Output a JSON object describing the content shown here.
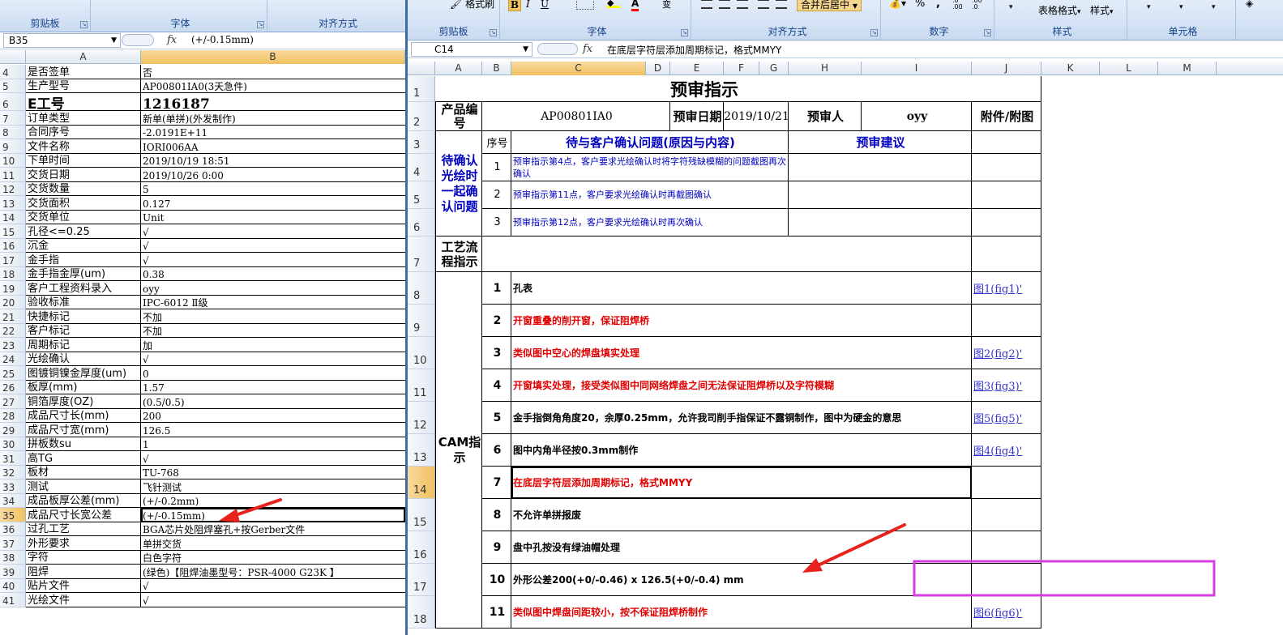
{
  "left": {
    "ribbon": {
      "groups": [
        "剪贴板",
        "字体",
        "对齐方式"
      ]
    },
    "name_box": "B35",
    "formula": "(+/-0.15mm)",
    "columns": [
      "A",
      "B"
    ],
    "rows": [
      {
        "num": "4",
        "a": "是否签单",
        "b": "否"
      },
      {
        "num": "5",
        "a": "生产型号",
        "b": "AP00801IA0(3天急件)"
      },
      {
        "num": "6",
        "a": "E工号",
        "b": "1216187"
      },
      {
        "num": "7",
        "a": "订单类型",
        "b": "新单(单拼)(外发制作)"
      },
      {
        "num": "8",
        "a": "合同序号",
        "b": "-2.0191E+11"
      },
      {
        "num": "9",
        "a": "文件名称",
        "b": "IORI006AA"
      },
      {
        "num": "10",
        "a": "下单时间",
        "b": "2019/10/19 18:51"
      },
      {
        "num": "11",
        "a": "交货日期",
        "b": "2019/10/26 0:00"
      },
      {
        "num": "12",
        "a": "交货数量",
        "b": "5"
      },
      {
        "num": "13",
        "a": "交货面积",
        "b": "0.127"
      },
      {
        "num": "14",
        "a": "交货单位",
        "b": "Unit"
      },
      {
        "num": "15",
        "a": "孔径<=0.25",
        "b": "√"
      },
      {
        "num": "16",
        "a": "沉金",
        "b": "√"
      },
      {
        "num": "17",
        "a": "金手指",
        "b": "√"
      },
      {
        "num": "18",
        "a": "金手指金厚(um)",
        "b": "0.38"
      },
      {
        "num": "19",
        "a": "客户工程资料录入",
        "b": "oyy"
      },
      {
        "num": "20",
        "a": "验收标准",
        "b": "IPC-6012 Ⅱ级"
      },
      {
        "num": "21",
        "a": "快捷标记",
        "b": "不加"
      },
      {
        "num": "22",
        "a": "客户标记",
        "b": "不加"
      },
      {
        "num": "23",
        "a": "周期标记",
        "b": "加"
      },
      {
        "num": "24",
        "a": "光绘确认",
        "b": "√"
      },
      {
        "num": "25",
        "a": "图镀铜镍金厚度(um)",
        "b": "0"
      },
      {
        "num": "26",
        "a": "板厚(mm)",
        "b": "1.57"
      },
      {
        "num": "27",
        "a": "铜箔厚度(OZ)",
        "b": "(0.5/0.5)"
      },
      {
        "num": "28",
        "a": "成品尺寸长(mm)",
        "b": "200"
      },
      {
        "num": "29",
        "a": "成品尺寸宽(mm)",
        "b": "126.5"
      },
      {
        "num": "30",
        "a": "拼板数su",
        "b": "1"
      },
      {
        "num": "31",
        "a": "高TG",
        "b": "√"
      },
      {
        "num": "32",
        "a": "板材",
        "b": "TU-768"
      },
      {
        "num": "33",
        "a": "测试",
        "b": "飞针测试"
      },
      {
        "num": "34",
        "a": "成品板厚公差(mm)",
        "b": "(+/-0.2mm)"
      },
      {
        "num": "35",
        "a": "成品尺寸长宽公差",
        "b": "(+/-0.15mm)"
      },
      {
        "num": "36",
        "a": "过孔工艺",
        "b": "BGA芯片处阻焊塞孔+按Gerber文件"
      },
      {
        "num": "37",
        "a": "外形要求",
        "b": "单拼交货"
      },
      {
        "num": "38",
        "a": "字符",
        "b": "白色字符"
      },
      {
        "num": "39",
        "a": "阻焊",
        "b": "(绿色)【阻焊油墨型号：PSR-4000 G23K 】"
      },
      {
        "num": "40",
        "a": "贴片文件",
        "b": "√"
      },
      {
        "num": "41",
        "a": "光绘文件",
        "b": "√"
      }
    ]
  },
  "right": {
    "ribbon": {
      "buttons": {
        "format_painter": "格式刷",
        "merge_center": "合并后居中",
        "table_format": "表格格式",
        "style": "样式",
        "percent": "%",
        "comma": ",",
        "bold": "B",
        "italic": "I",
        "underline": "U",
        "font_color": "A",
        "inc_decimal": ".0 .00",
        "dec_decimal": ".00 .0",
        "wrap": "变"
      },
      "groups": [
        "剪贴板",
        "字体",
        "对齐方式",
        "数字",
        "样式",
        "单元格"
      ]
    },
    "name_box": "C14",
    "formula": "在底层字符层添加周期标记，格式MMYY",
    "columns": [
      "A",
      "B",
      "C",
      "D",
      "E",
      "F",
      "G",
      "H",
      "I",
      "J",
      "K",
      "L",
      "M"
    ],
    "row_numbers": [
      "1",
      "2",
      "3",
      "4",
      "5",
      "6",
      "7",
      "8",
      "9",
      "10",
      "11",
      "12",
      "13",
      "14",
      "15",
      "16",
      "17",
      "18"
    ],
    "sheet": {
      "title": "预审指示",
      "product_label": "产品编号",
      "product_value": "AP00801IA0",
      "date_label": "预审日期",
      "date_value": "2019/10/21",
      "reviewer_label": "预审人",
      "reviewer_value": "oyy",
      "attach_label": "附件/附图",
      "seq_label": "序号",
      "confirm_header": "待与客户确认问题(原因与内容)",
      "advice_header": "预审建议",
      "confirm_section": "待确认光绘时一起确认问题",
      "confirm_items": [
        {
          "seq": "1",
          "text": "预审指示第4点，客户要求光绘确认时将字符残缺模糊的问题截图再次确认"
        },
        {
          "seq": "2",
          "text": "预审指示第11点，客户要求光绘确认时再截图确认"
        },
        {
          "seq": "3",
          "text": "预审指示第12点，客户要求光绘确认时再次确认"
        }
      ],
      "process_label": "工艺流程指示",
      "cam_label": "CAM指示",
      "cam_items": [
        {
          "seq": "1",
          "text": "孔表",
          "red": false,
          "link": "图1(fig1)'"
        },
        {
          "seq": "2",
          "text": "开窗重叠的削开窗，保证阻焊桥",
          "red": true,
          "link": ""
        },
        {
          "seq": "3",
          "text": "类似图中空心的焊盘填实处理",
          "red": true,
          "link": "图2(fig2)'"
        },
        {
          "seq": "4",
          "text": "开窗填实处理，接受类似图中同网络焊盘之间无法保证阻焊桥以及字符模糊",
          "red": true,
          "link": "图3(fig3)'"
        },
        {
          "seq": "5",
          "text": "金手指倒角角度20，余厚0.25mm，允许我司削手指保证不露铜制作，图中为硬金的意思",
          "red": false,
          "link": "图5(fig5)'"
        },
        {
          "seq": "6",
          "text": "图中内角半径按0.3mm制作",
          "red": false,
          "link": "图4(fig4)'"
        },
        {
          "seq": "7",
          "text": "在底层字符层添加周期标记，格式MMYY",
          "red": true,
          "link": ""
        },
        {
          "seq": "8",
          "text": "不允许单拼报废",
          "red": false,
          "link": ""
        },
        {
          "seq": "9",
          "text": "盘中孔按没有绿油帽处理",
          "red": false,
          "link": ""
        },
        {
          "seq": "10",
          "text": "外形公差200(+0/-0.46) x 126.5(+0/-0.4) mm",
          "red": false,
          "link": ""
        },
        {
          "seq": "11",
          "text": "类似图中焊盘间距较小，按不保证阻焊桥制作",
          "red": true,
          "link": "图6(fig6)'"
        }
      ]
    }
  },
  "colors": {
    "annotation_arrow": "#e8231e",
    "highlight_box": "#d63ee0",
    "ribbon": "#dbe7f6",
    "selected_header": "#f4c96e"
  }
}
